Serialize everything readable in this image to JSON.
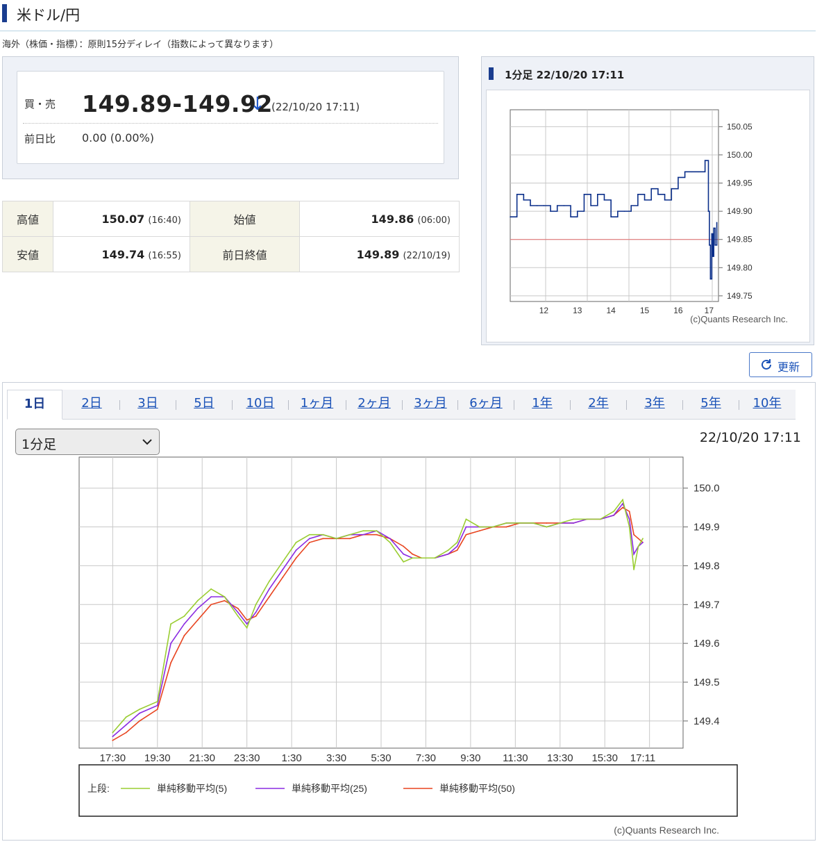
{
  "page": {
    "title": "米ドル/円",
    "notice": "海外（株価・指標）：原則15分ディレイ（指数によって異なります）"
  },
  "quote": {
    "bid_ask_label": "買・売",
    "price": "149.89-149.92",
    "direction_icon": "down-arrow-icon",
    "timestamp": "(22/10/20 17:11)",
    "change_label": "前日比",
    "change_value": "0.00 (0.00%)"
  },
  "stats": {
    "high_label": "高値",
    "high_value": "150.07",
    "high_time": "(16:40)",
    "open_label": "始値",
    "open_value": "149.86",
    "open_time": "(06:00)",
    "low_label": "安値",
    "low_value": "149.74",
    "low_time": "(16:55)",
    "prev_close_label": "前日終値",
    "prev_close_value": "149.89",
    "prev_close_date": "(22/10/19)"
  },
  "mini_chart_panel": {
    "title": "1分足 22/10/20 17:11"
  },
  "refresh": {
    "label": "更新",
    "icon": "refresh-icon"
  },
  "tabs": [
    "1日",
    "2日",
    "3日",
    "5日",
    "10日",
    "1ヶ月",
    "2ヶ月",
    "3ヶ月",
    "6ヶ月",
    "1年",
    "2年",
    "3年",
    "5年",
    "10年"
  ],
  "active_tab": "1日",
  "interval_select": {
    "value": "1分足"
  },
  "main_chart_timestamp": "22/10/20 17:11",
  "colors": {
    "accent": "#1a3d8f",
    "price_line": "#0b2f8a",
    "ref_line": "#e36c6c",
    "ma5": "#9acd32",
    "ma25": "#8a2be2",
    "ma50": "#e8441f"
  },
  "chart_data": [
    {
      "type": "line",
      "x_tick_labels": [
        "12",
        "13",
        "14",
        "15",
        "16",
        "17"
      ],
      "y_tick_labels": [
        "150.05",
        "150.00",
        "149.95",
        "149.90",
        "149.85",
        "149.80",
        "149.75"
      ],
      "ylim": [
        149.74,
        150.08
      ],
      "xlim": [
        11.0,
        17.2
      ],
      "reference_line": 149.85,
      "grid": true,
      "credit": "(c)Quants Research Inc.",
      "series": [
        {
          "x": [
            11.0,
            11.2,
            11.4,
            11.6,
            11.8,
            12.0,
            12.2,
            12.4,
            12.6,
            12.8,
            13.0,
            13.2,
            13.4,
            13.6,
            13.8,
            14.0,
            14.2,
            14.4,
            14.6,
            14.8,
            15.0,
            15.2,
            15.4,
            15.6,
            15.8,
            16.0,
            16.2,
            16.4,
            16.6,
            16.8,
            16.9,
            16.93,
            16.96,
            17.0,
            17.03,
            17.06,
            17.1,
            17.15
          ],
          "y": [
            149.89,
            149.93,
            149.92,
            149.91,
            149.91,
            149.91,
            149.9,
            149.91,
            149.91,
            149.89,
            149.9,
            149.93,
            149.91,
            149.93,
            149.92,
            149.89,
            149.9,
            149.9,
            149.91,
            149.93,
            149.92,
            149.94,
            149.93,
            149.92,
            149.94,
            149.96,
            149.97,
            149.97,
            149.97,
            149.99,
            149.9,
            149.84,
            149.78,
            149.86,
            149.82,
            149.87,
            149.84,
            149.88
          ]
        }
      ]
    },
    {
      "type": "line",
      "x_tick_labels": [
        "17:30",
        "19:30",
        "21:30",
        "23:30",
        "1:30",
        "3:30",
        "5:30",
        "7:30",
        "9:30",
        "11:30",
        "13:30",
        "15:30",
        "17:11"
      ],
      "y_tick_labels": [
        "150.0",
        "149.9",
        "149.8",
        "149.7",
        "149.6",
        "149.5",
        "149.4"
      ],
      "ylim": [
        149.33,
        150.08
      ],
      "xlim": [
        -0.75,
        12.75
      ],
      "grid": true,
      "legend_prefix": "上段:",
      "credit": "(c)Quants Research Inc.",
      "series": [
        {
          "name": "単純移動平均(5)",
          "x": [
            0,
            0.3,
            0.6,
            1.0,
            1.3,
            1.6,
            1.9,
            2.2,
            2.5,
            2.8,
            3.0,
            3.2,
            3.5,
            3.8,
            4.1,
            4.4,
            4.7,
            5.0,
            5.3,
            5.6,
            5.9,
            6.2,
            6.5,
            6.7,
            6.9,
            7.2,
            7.5,
            7.7,
            7.9,
            8.2,
            8.5,
            8.8,
            9.1,
            9.4,
            9.7,
            10.0,
            10.3,
            10.6,
            10.9,
            11.2,
            11.4,
            11.55,
            11.65,
            11.75,
            11.85
          ],
          "y": [
            149.37,
            149.41,
            149.43,
            149.45,
            149.65,
            149.67,
            149.71,
            149.74,
            149.72,
            149.67,
            149.64,
            149.7,
            149.76,
            149.81,
            149.86,
            149.88,
            149.88,
            149.87,
            149.88,
            149.89,
            149.89,
            149.86,
            149.81,
            149.82,
            149.82,
            149.82,
            149.84,
            149.86,
            149.92,
            149.9,
            149.9,
            149.91,
            149.91,
            149.91,
            149.9,
            149.91,
            149.92,
            149.92,
            149.92,
            149.94,
            149.97,
            149.9,
            149.79,
            149.85,
            149.87
          ]
        },
        {
          "name": "単純移動平均(25)",
          "x": [
            0,
            0.3,
            0.6,
            1.0,
            1.3,
            1.6,
            1.9,
            2.2,
            2.5,
            2.8,
            3.0,
            3.2,
            3.5,
            3.8,
            4.1,
            4.4,
            4.7,
            5.0,
            5.3,
            5.6,
            5.9,
            6.2,
            6.5,
            6.7,
            6.9,
            7.2,
            7.5,
            7.7,
            7.9,
            8.2,
            8.5,
            8.8,
            9.1,
            9.4,
            9.7,
            10.0,
            10.3,
            10.6,
            10.9,
            11.2,
            11.4,
            11.55,
            11.65,
            11.75,
            11.85
          ],
          "y": [
            149.36,
            149.39,
            149.42,
            149.44,
            149.6,
            149.65,
            149.69,
            149.72,
            149.72,
            149.68,
            149.65,
            149.68,
            149.74,
            149.79,
            149.84,
            149.87,
            149.88,
            149.87,
            149.88,
            149.88,
            149.89,
            149.87,
            149.83,
            149.82,
            149.82,
            149.82,
            149.83,
            149.85,
            149.9,
            149.9,
            149.9,
            149.91,
            149.91,
            149.91,
            149.9,
            149.91,
            149.91,
            149.92,
            149.92,
            149.93,
            149.96,
            149.92,
            149.83,
            149.85,
            149.86
          ]
        },
        {
          "name": "単純移動平均(50)",
          "x": [
            0,
            0.3,
            0.6,
            1.0,
            1.3,
            1.6,
            1.9,
            2.2,
            2.5,
            2.8,
            3.0,
            3.2,
            3.5,
            3.8,
            4.1,
            4.4,
            4.7,
            5.0,
            5.3,
            5.6,
            5.9,
            6.2,
            6.5,
            6.7,
            6.9,
            7.2,
            7.5,
            7.7,
            7.9,
            8.2,
            8.5,
            8.8,
            9.1,
            9.4,
            9.7,
            10.0,
            10.3,
            10.6,
            10.9,
            11.2,
            11.4,
            11.55,
            11.65,
            11.75,
            11.85
          ],
          "y": [
            149.35,
            149.37,
            149.4,
            149.43,
            149.55,
            149.62,
            149.66,
            149.7,
            149.71,
            149.69,
            149.66,
            149.67,
            149.72,
            149.77,
            149.82,
            149.86,
            149.87,
            149.87,
            149.87,
            149.88,
            149.88,
            149.87,
            149.85,
            149.83,
            149.82,
            149.82,
            149.83,
            149.84,
            149.88,
            149.89,
            149.9,
            149.9,
            149.91,
            149.91,
            149.91,
            149.91,
            149.91,
            149.92,
            149.92,
            149.93,
            149.95,
            149.94,
            149.88,
            149.87,
            149.86
          ]
        }
      ]
    }
  ]
}
